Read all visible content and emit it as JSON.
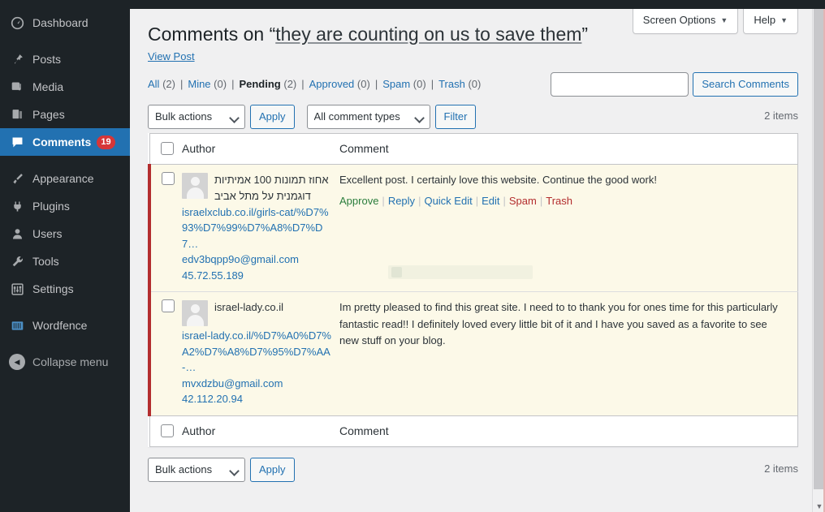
{
  "admin": {
    "sidebar": {
      "items": [
        {
          "label": "Dashboard",
          "icon": "dashboard-icon",
          "current": false,
          "badge": null
        },
        {
          "label": "Posts",
          "icon": "pin-icon",
          "current": false,
          "badge": null
        },
        {
          "label": "Media",
          "icon": "media-icon",
          "current": false,
          "badge": null
        },
        {
          "label": "Pages",
          "icon": "pages-icon",
          "current": false,
          "badge": null
        },
        {
          "label": "Comments",
          "icon": "comment-bubble-icon",
          "current": true,
          "badge": "19"
        },
        {
          "label": "Appearance",
          "icon": "paintbrush-icon",
          "current": false,
          "badge": null
        },
        {
          "label": "Plugins",
          "icon": "plug-icon",
          "current": false,
          "badge": null
        },
        {
          "label": "Users",
          "icon": "user-icon",
          "current": false,
          "badge": null
        },
        {
          "label": "Tools",
          "icon": "wrench-icon",
          "current": false,
          "badge": null
        },
        {
          "label": "Settings",
          "icon": "sliders-icon",
          "current": false,
          "badge": null
        },
        {
          "label": "Wordfence",
          "icon": "wordfence-icon",
          "current": false,
          "badge": null
        }
      ],
      "collapse_label": "Collapse menu"
    },
    "screen_meta": {
      "screen_options_label": "Screen Options",
      "help_label": "Help",
      "caret": "▼"
    }
  },
  "page": {
    "title_prefix": "Comments on",
    "quote_open": "“",
    "quote_close": "”",
    "post_title": "they are counting on us to save them",
    "view_post_label": "View Post"
  },
  "status_filters": {
    "items": [
      {
        "label": "All",
        "count": "(2)",
        "current": false
      },
      {
        "label": "Mine",
        "count": "(0)",
        "current": false
      },
      {
        "label": "Pending",
        "count": "(2)",
        "current": true
      },
      {
        "label": "Approved",
        "count": "(0)",
        "current": false
      },
      {
        "label": "Spam",
        "count": "(0)",
        "current": false
      },
      {
        "label": "Trash",
        "count": "(0)",
        "current": false
      }
    ],
    "separator": "|"
  },
  "search": {
    "value": "",
    "placeholder": "",
    "button_label": "Search Comments"
  },
  "tablenav_top": {
    "bulk_actions_selected": "Bulk actions",
    "apply_label": "Apply",
    "comment_types_selected": "All comment types",
    "filter_label": "Filter",
    "displaying_num": "2 items"
  },
  "tablenav_bottom": {
    "bulk_actions_selected": "Bulk actions",
    "apply_label": "Apply",
    "displaying_num": "2 items"
  },
  "table": {
    "columns": {
      "author": "Author",
      "comment": "Comment"
    },
    "rows": [
      {
        "author": {
          "name": "אחוז תמונות 100 אמיתיות דוגמנית על מתל אביב",
          "url": "israelxclub.co.il/girls-cat/%D7%93%D7%99%D7%A8%D7%D7…",
          "email": "edv3bqpp9o@gmail.com",
          "ip": "45.72.55.189"
        },
        "comment_text": "Excellent post. I certainly love this website. Continue the good work!",
        "actions": [
          {
            "label": "Approve",
            "kind": "approve"
          },
          {
            "label": "Reply",
            "kind": "reply"
          },
          {
            "label": "Quick Edit",
            "kind": "quickedit"
          },
          {
            "label": "Edit",
            "kind": "edit"
          },
          {
            "label": "Spam",
            "kind": "spam"
          },
          {
            "label": "Trash",
            "kind": "trash"
          }
        ]
      },
      {
        "author": {
          "name": "israel-lady.co.il",
          "url": "israel-lady.co.il/%D7%A0%D7%A2%D7%A8%D7%95%D7%AA-…",
          "email": "mvxdzbu@gmail.com",
          "ip": "42.112.20.94"
        },
        "comment_text": "Im pretty pleased to find this great site. I need to to thank you for ones time for this particularly fantastic read!! I definitely loved every little bit of it and I have you saved as a favorite to see new stuff on your blog.",
        "actions": []
      }
    ]
  },
  "colors": {
    "sidebar_bg": "#1d2327",
    "current_menu": "#2271b1",
    "badge": "#d63638",
    "link": "#2271b1",
    "pending_row_bg": "#fcf9e8",
    "pending_border": "#b32d2e",
    "approve": "#2a7d3c",
    "danger": "#b32d2e"
  }
}
